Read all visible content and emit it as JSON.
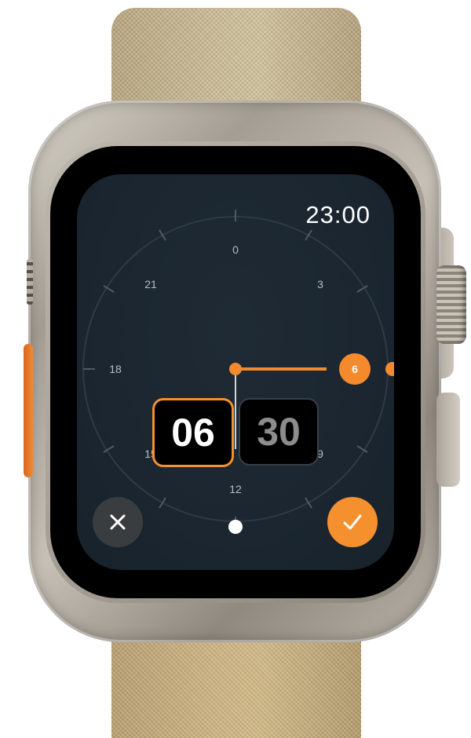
{
  "watch": {
    "clock_time": "23:00",
    "dial_labels": {
      "top": "0",
      "upper_right": "3",
      "right": "6",
      "lower_right": "9",
      "bottom": "12",
      "lower_left": "15",
      "left": "18",
      "upper_left": "21"
    },
    "selected_marker_label": "6",
    "hour_value": "06",
    "minute_value": "30"
  },
  "controls": {
    "cancel_icon": "close-icon",
    "confirm_icon": "checkmark-icon"
  },
  "colors": {
    "accent": "#f5902f",
    "screen_background": "#1b2630",
    "box_background": "#000000",
    "cancel_button": "#3a3d40"
  }
}
